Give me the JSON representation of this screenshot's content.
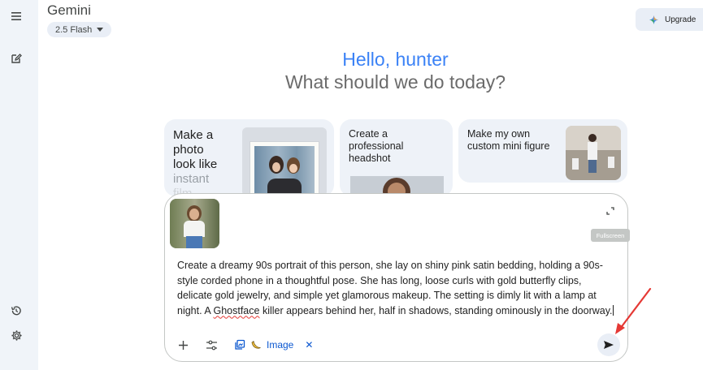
{
  "app": {
    "name": "Gemini",
    "model_selector": "2.5 Flash"
  },
  "header": {
    "upgrade_label": "Upgrade"
  },
  "sidebar": {
    "menu_icon": "hamburger-menu-icon",
    "new_chat_icon": "edit-square-icon",
    "activity_icon": "history-icon",
    "settings_icon": "gear-icon"
  },
  "greeting": {
    "hello": "Hello, hunter",
    "subtitle": "What should we do today?"
  },
  "suggestions": [
    {
      "line1": "Make a",
      "line2": "photo",
      "line3": "look like",
      "line4": "instant",
      "line5": "film"
    },
    {
      "text": "Create a professional headshot"
    },
    {
      "text": "Make my own custom mini figure"
    }
  ],
  "composer": {
    "tooltip": "Fullscreen",
    "prompt_before": "Create a dreamy 90s portrait of this person, she lay on shiny pink satin bedding, holding a 90s-style corded phone in a thoughtful pose. She has long, loose curls with gold butterfly clips, delicate gold jewelry, and simple yet glamorous makeup. The setting is dimly lit with a lamp at night. A ",
    "prompt_misspelled": "Ghostface",
    "prompt_after": " killer appears behind her, half in shadows, standing ominously in the doorway.",
    "image_chip_label": "Image",
    "tools": [
      "add-icon",
      "tools-sliders-icon",
      "image-gallery-icon",
      "banana-icon",
      "close-icon",
      "send-icon",
      "fullscreen-icon"
    ]
  },
  "colors": {
    "greeting_blue": "#3b82f6",
    "rail_bg": "#f0f4f9",
    "annotation_red": "#e53935",
    "chip_blue": "#0b57d0"
  }
}
